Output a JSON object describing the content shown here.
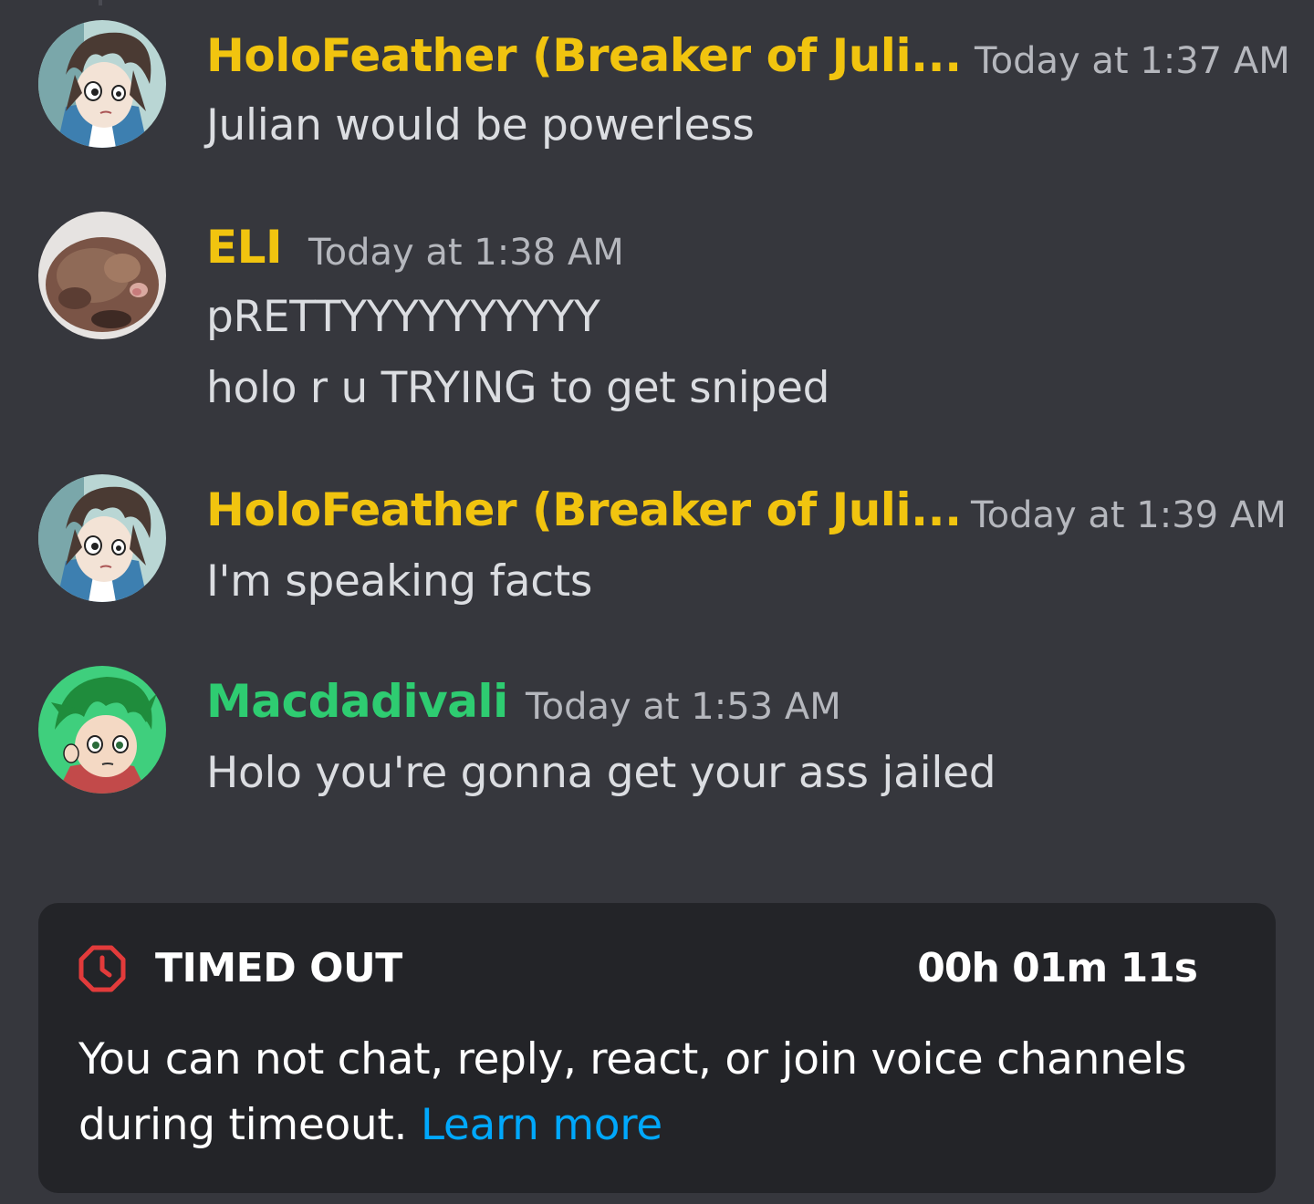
{
  "colors": {
    "background": "#36373d",
    "author_yellow": "#f1c40f",
    "author_green": "#2ecc71",
    "timestamp": "#b5b7bd",
    "message_text": "#dbdde1",
    "banner_bg": "#232428",
    "timeout_icon": "#e23b3b",
    "link": "#00a8fc"
  },
  "messages": [
    {
      "author": "HoloFeather (Breaker of Juli...",
      "timestamp": "Today at 1:37 AM",
      "avatar_icon": "anime-character-avatar-icon",
      "lines": [
        "Julian would be powerless"
      ]
    },
    {
      "author": "ELI",
      "timestamp": "Today at 1:38 AM",
      "avatar_icon": "photo-avatar-icon",
      "lines": [
        "pRETTYYYYYYYYYY",
        "holo r u TRYING to get sniped"
      ]
    },
    {
      "author": "HoloFeather (Breaker of Juli...",
      "timestamp": "Today at 1:39 AM",
      "avatar_icon": "anime-character-avatar-icon",
      "lines": [
        "I'm speaking facts"
      ]
    },
    {
      "author": "Macdadivali",
      "timestamp": "Today at 1:53 AM",
      "avatar_icon": "anime-character-avatar-icon",
      "lines": [
        "Holo you're gonna get your ass jailed"
      ]
    }
  ],
  "timeout": {
    "icon": "clock-stop-icon",
    "title": "TIMED OUT",
    "remaining": "00h 01m 11s",
    "message": "You can not chat, reply, react, or join voice channels during timeout.",
    "link_label": "Learn more"
  }
}
